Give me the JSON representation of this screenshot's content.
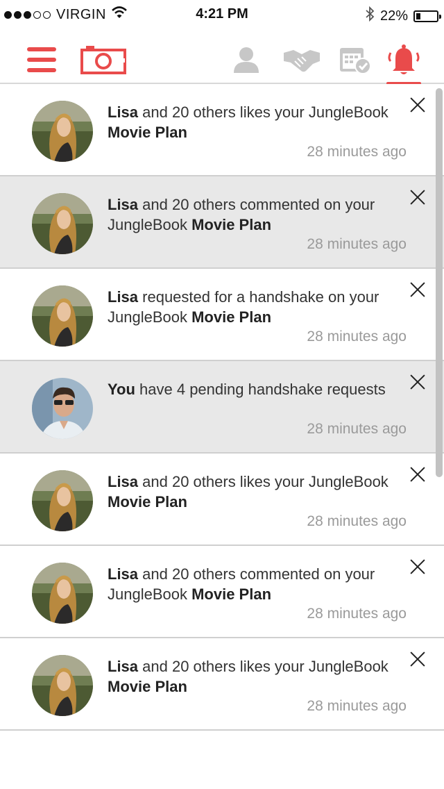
{
  "status_bar": {
    "carrier": "VIRGIN",
    "time": "4:21 PM",
    "battery_text": "22%",
    "battery_level": 0.22,
    "signal_bars_filled": 3,
    "signal_bars_total": 5
  },
  "nav": {
    "icons": [
      "menu-icon",
      "camera-icon",
      "person-icon",
      "handshake-icon",
      "calendar-check-icon",
      "bell-icon"
    ],
    "active": "bell-icon",
    "accent_color": "#e94b4b",
    "inactive_color": "#c7c7c7"
  },
  "notifications": [
    {
      "actor": "Lisa",
      "middle": " and 20 others likes your JungleBook ",
      "object": "Movie Plan",
      "time": "28 minutes ago",
      "avatar": "woman",
      "highlight": false
    },
    {
      "actor": "Lisa",
      "middle": " and 20 others commented on your JungleBook ",
      "object": "Movie Plan",
      "time": "28 minutes ago",
      "avatar": "woman",
      "highlight": true
    },
    {
      "actor": "Lisa",
      "middle": " requested for a handshake on your JungleBook ",
      "object": "Movie Plan",
      "time": "28 minutes ago",
      "avatar": "woman",
      "highlight": false
    },
    {
      "actor": "You",
      "middle": " have 4 pending handshake requests",
      "object": "",
      "time": "28 minutes ago",
      "avatar": "man",
      "highlight": true
    },
    {
      "actor": "Lisa",
      "middle": " and 20 others likes your JungleBook ",
      "object": "Movie Plan",
      "time": "28 minutes ago",
      "avatar": "woman",
      "highlight": false
    },
    {
      "actor": "Lisa",
      "middle": " and 20 others commented on your JungleBook ",
      "object": "Movie Plan",
      "time": "28 minutes ago",
      "avatar": "woman",
      "highlight": false
    },
    {
      "actor": "Lisa",
      "middle": " and 20 others likes your JungleBook ",
      "object": "Movie Plan",
      "time": "28 minutes ago",
      "avatar": "woman",
      "highlight": false
    }
  ]
}
